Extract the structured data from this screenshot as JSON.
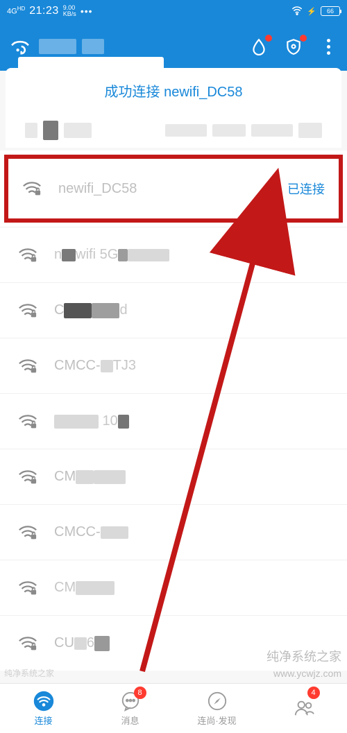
{
  "status": {
    "network_label": "4G",
    "network_sup": "HD",
    "time": "21:23",
    "speed_top": "9.00",
    "speed_bottom": "KB/s",
    "battery": "66"
  },
  "header": {
    "water_icon": "water-drop-icon",
    "shield_icon": "shield-icon",
    "menu_icon": "menu-icon"
  },
  "success": {
    "text": "成功连接 newifi_DC58"
  },
  "list": {
    "connected_label": "已连接",
    "items": [
      {
        "name": "newifi_DC58",
        "connected": true,
        "highlighted": true
      },
      {
        "name": "newifi 5G_DC58"
      },
      {
        "name": "CU_rkukd"
      },
      {
        "name": "CMCC-rTJ3"
      },
      {
        "name": "CMCC-102"
      },
      {
        "name": "CMCC-209"
      },
      {
        "name": "CMCC-309"
      },
      {
        "name": "CMCC-2_1"
      },
      {
        "name": "CU_6"
      },
      {
        "name": " "
      }
    ]
  },
  "nav": {
    "items": [
      {
        "label": "连接",
        "icon": "wifi",
        "active": true
      },
      {
        "label": "消息",
        "icon": "message",
        "badge": "8"
      },
      {
        "label": "连尚·发现",
        "icon": "compass"
      },
      {
        "label": "",
        "icon": "people",
        "badge": "4"
      }
    ]
  },
  "watermark": {
    "line1": "纯净系统之家",
    "line2": "www.ycwjz.com",
    "left": "纯净系统之家"
  }
}
